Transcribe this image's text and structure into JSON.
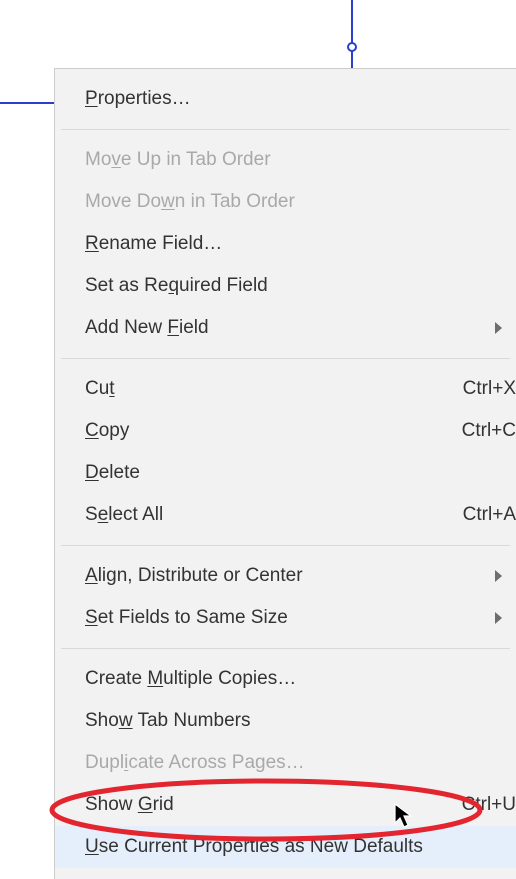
{
  "canvas": {
    "handle_name": "selection-handle"
  },
  "menu": {
    "properties": {
      "pre": "",
      "m": "P",
      "post": "roperties…"
    },
    "move_up": {
      "pre": "Mo",
      "m": "v",
      "post": "e Up in Tab Order"
    },
    "move_down": {
      "pre": "Move Do",
      "m": "w",
      "post": "n in Tab Order"
    },
    "rename": {
      "pre": "",
      "m": "R",
      "post": "ename Field…"
    },
    "required": {
      "pre": "Set as Re",
      "m": "q",
      "post": "uired Field"
    },
    "add_new": {
      "pre": "Add New ",
      "m": "F",
      "post": "ield"
    },
    "cut": {
      "pre": "Cu",
      "m": "t",
      "post": ""
    },
    "copy": {
      "pre": "",
      "m": "C",
      "post": "opy"
    },
    "delete": {
      "pre": "",
      "m": "D",
      "post": "elete"
    },
    "select_all": {
      "pre": "S",
      "m": "e",
      "post": "lect All"
    },
    "align": {
      "pre": "",
      "m": "A",
      "post": "lign, Distribute or Center"
    },
    "same_size": {
      "pre": "",
      "m": "S",
      "post": "et Fields to Same Size"
    },
    "multiple": {
      "pre": "Create ",
      "m": "M",
      "post": "ultiple Copies…"
    },
    "tab_numbers": {
      "pre": "Sho",
      "m": "w",
      "post": " Tab Numbers"
    },
    "duplicate": {
      "pre": "Dupl",
      "m": "i",
      "post": "cate Across Pages…"
    },
    "show_grid": {
      "pre": "Show ",
      "m": "G",
      "post": "rid"
    },
    "use_defaults": {
      "pre": "",
      "m": "U",
      "post": "se Current Properties as New Defaults"
    },
    "shortcut_cut": "Ctrl+X",
    "shortcut_copy": "Ctrl+C",
    "shortcut_select_all": "Ctrl+A",
    "shortcut_grid": "Ctrl+U"
  }
}
